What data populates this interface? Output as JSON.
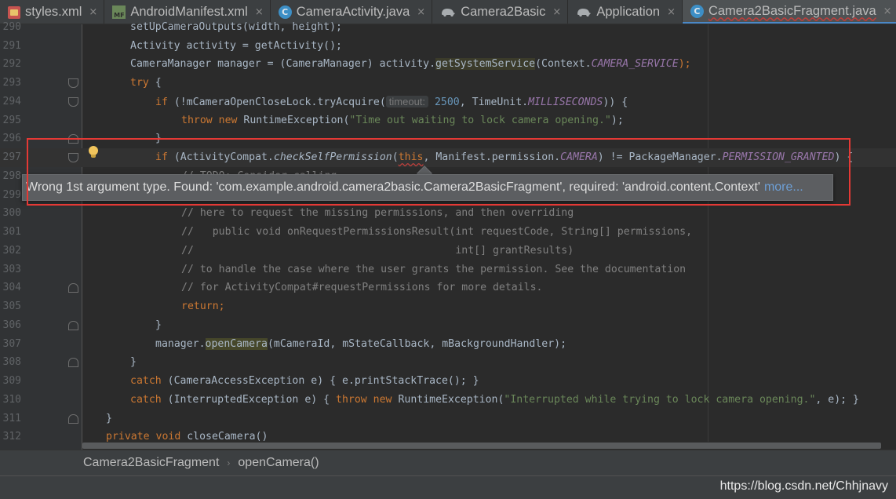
{
  "tabs": [
    {
      "label": "styles.xml",
      "icon": "xml-file-icon",
      "active": false
    },
    {
      "label": "AndroidManifest.xml",
      "icon": "manifest-file-icon",
      "active": false
    },
    {
      "label": "CameraActivity.java",
      "icon": "java-class-icon",
      "active": false
    },
    {
      "label": "Camera2Basic",
      "icon": "gradle-elephant-icon",
      "active": false
    },
    {
      "label": "Application",
      "icon": "gradle-elephant-icon",
      "active": false
    },
    {
      "label": "Camera2BasicFragment.java",
      "icon": "java-class-icon",
      "active": true
    }
  ],
  "close_glyph": "×",
  "editor": {
    "line_numbers": [
      "290",
      "291",
      "292",
      "293",
      "294",
      "295",
      "296",
      "297",
      "298",
      "299",
      "300",
      "301",
      "302",
      "303",
      "304",
      "305",
      "306",
      "307",
      "308",
      "309",
      "310",
      "311",
      "312"
    ],
    "code": {
      "l290": "setUpCameraOutputs(width, height);",
      "l291": "Activity activity = getActivity();",
      "l292": {
        "a": "CameraManager manager = (CameraManager) activity.",
        "b": "getSystemService",
        "c": "(Context.",
        "d": "CAMERA_SERVICE",
        "e": ");"
      },
      "l293": {
        "kw": "try",
        "rest": " {"
      },
      "l294": {
        "kw": "if",
        "a": " (!mCameraOpenCloseLock.tryAcquire(",
        "hint": "timeout:",
        "num": "2500",
        "b": ", TimeUnit.",
        "fld": "MILLISECONDS",
        "c": ")) {"
      },
      "l295": {
        "kw1": "throw",
        "kw2": "new",
        "a": " RuntimeException(",
        "str": "\"Time out waiting to lock camera opening.\"",
        "b": ");"
      },
      "l296": "}",
      "l297": {
        "kw": "if",
        "a": " (ActivityCompat.",
        "mth": "checkSelfPermission",
        "b": "(",
        "err": "this",
        "c": ", Manifest.permission.",
        "fld1": "CAMERA",
        "d": ") != PackageManager.",
        "fld2": "PERMISSION_GRANTED",
        "e": ") {"
      },
      "l298": "// TODO: Consider calling",
      "l300": "// here to request the missing permissions, and then overriding",
      "l301": "//   public void onRequestPermissionsResult(int requestCode, String[] permissions,",
      "l302": "//                                          int[] grantResults)",
      "l303": "// to handle the case where the user grants the permission. See the documentation",
      "l304": "// for ActivityCompat#requestPermissions for more details.",
      "l305": {
        "kw": "return",
        "rest": ";"
      },
      "l306": "}",
      "l307": {
        "a": "manager.",
        "hl": "openCamera",
        "b": "(mCameraId, mStateCallback, mBackgroundHandler);"
      },
      "l308": "}",
      "l309": {
        "kw": "catch",
        "a": " (CameraAccessException e) { e.printStackTrace(); }"
      },
      "l310": {
        "kw": "catch",
        "a": " (InterruptedException e) { ",
        "kw1": "throw",
        "kw2": "new",
        "b": " RuntimeException(",
        "str": "\"Interrupted while trying to lock camera opening.\"",
        "c": ", e); }"
      },
      "l311": "}",
      "l312": {
        "kw": "private void",
        "a": " closeCamera()"
      }
    },
    "tooltip": {
      "message": "Wrong 1st argument type. Found: 'com.example.android.camera2basic.Camera2BasicFragment', required: 'android.content.Context'",
      "more_link": "more..."
    }
  },
  "breadcrumb": {
    "items": [
      "Camera2BasicFragment",
      "openCamera()"
    ],
    "separator": "›"
  },
  "watermark": "https://blog.csdn.net/Chhjnavy",
  "colors": {
    "keyword": "#cc7832",
    "comment": "#808080",
    "string": "#6a8759",
    "field": "#9876aa",
    "number": "#6897bb",
    "error": "#bc3f3c",
    "annotation": "#e53935"
  }
}
